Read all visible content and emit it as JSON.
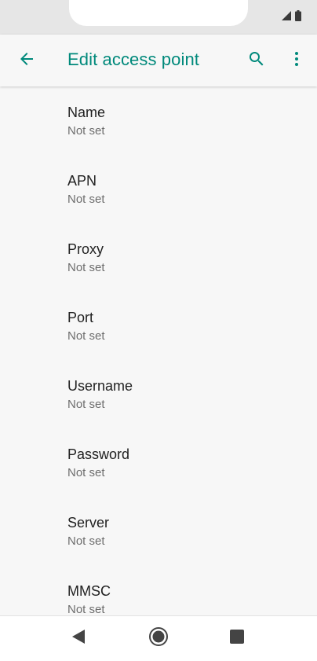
{
  "colors": {
    "accent": "#00897b",
    "title_text": "#212121",
    "summary_text": "#6d6d6d",
    "background": "#f7f7f7"
  },
  "status_bar": {
    "icons": [
      "signal-icon",
      "battery-icon"
    ]
  },
  "app_bar": {
    "title": "Edit access point",
    "icons": [
      "back-arrow-icon",
      "search-icon",
      "more-vert-icon"
    ]
  },
  "settings": {
    "items": [
      {
        "title": "Name",
        "summary": "Not set"
      },
      {
        "title": "APN",
        "summary": "Not set"
      },
      {
        "title": "Proxy",
        "summary": "Not set"
      },
      {
        "title": "Port",
        "summary": "Not set"
      },
      {
        "title": "Username",
        "summary": "Not set"
      },
      {
        "title": "Password",
        "summary": "Not set"
      },
      {
        "title": "Server",
        "summary": "Not set"
      },
      {
        "title": "MMSC",
        "summary": "Not set"
      }
    ]
  },
  "nav_bar": {
    "icons": [
      "nav-back-icon",
      "nav-home-icon",
      "nav-recents-icon"
    ]
  }
}
